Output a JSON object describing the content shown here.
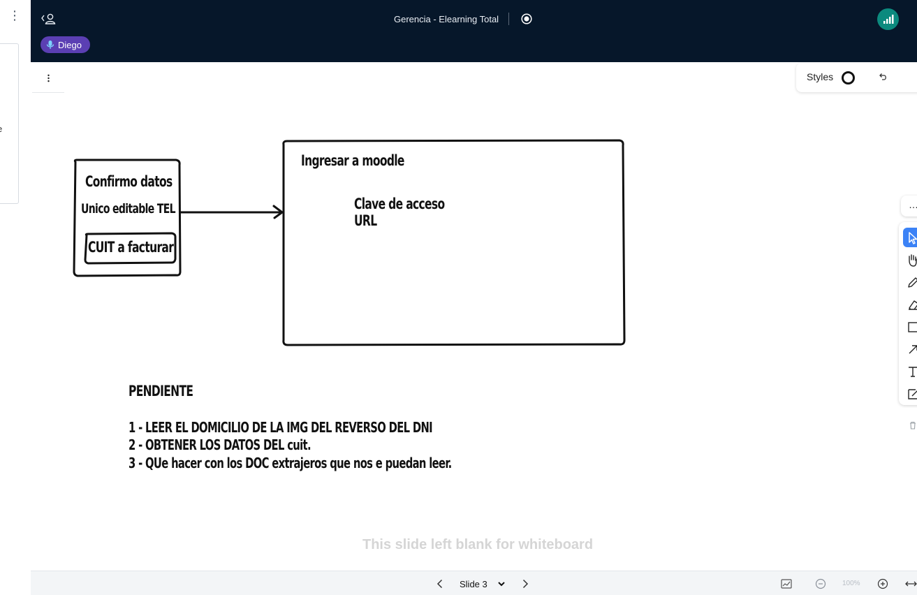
{
  "app": {
    "meeting_title": "Gerencia - Elearning Total",
    "presenter_name": "Diego",
    "connection_status_color": "#0c8a7e",
    "header_color": "#06172a"
  },
  "toolbar": {
    "styles_label": "Styles",
    "more_label": "…",
    "tools": [
      "select-icon",
      "pan-icon",
      "pencil-icon",
      "eraser-icon",
      "rectangle-icon",
      "arrow-icon",
      "text-icon",
      "note-icon",
      "trash-icon"
    ],
    "active_tool": "select-icon",
    "active_color": "#3b82f6"
  },
  "left_panel": {
    "fragment_text": "e"
  },
  "whiteboard": {
    "box_small": {
      "line1": "Confirmo datos",
      "line2": "Unico editable TEL",
      "inner_box_text": "CUIT a facturar"
    },
    "box_large": {
      "title": "Ingresar a moodle",
      "line1": "Clave de acceso",
      "line2": "URL"
    },
    "pending": {
      "title": "PENDIENTE",
      "items": [
        "1 - LEER EL DOMICILIO DE LA IMG DEL REVERSO DEL DNI",
        "2 - OBTENER LOS DATOS DEL cuit.",
        "3 - QUe hacer con los DOC extrajeros que nos e puedan leer."
      ]
    },
    "blank_message": "This slide left blank for whiteboard"
  },
  "bottom_bar": {
    "slide_label": "Slide 3",
    "zoom_label": "100%"
  }
}
